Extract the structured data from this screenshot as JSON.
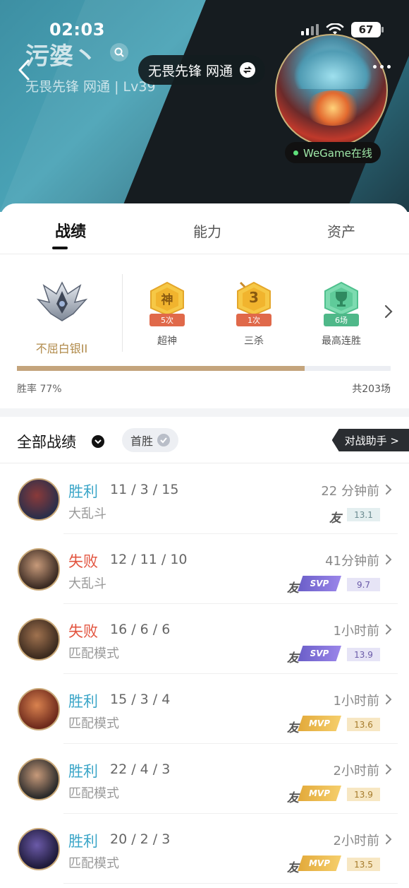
{
  "status_bar": {
    "time": "02:03",
    "battery": "67"
  },
  "profile": {
    "name": "污婆丶",
    "subtitle": "无畏先锋 网通 | Lv39",
    "server": "无畏先锋 网通",
    "online_status": "WeGame在线"
  },
  "tabs": [
    {
      "label": "战绩",
      "active": true
    },
    {
      "label": "能力",
      "active": false
    },
    {
      "label": "资产",
      "active": false
    }
  ],
  "rank": {
    "name": "不屈白银II"
  },
  "badges": [
    {
      "glyph": "神",
      "count": "5次",
      "label": "超神",
      "color": "#f2b63a"
    },
    {
      "glyph": "3",
      "count": "1次",
      "label": "三杀",
      "color": "#f2b63a"
    },
    {
      "glyph": "trophy-icon",
      "count": "6场",
      "label": "最高连胜",
      "color": "#5cc99a"
    }
  ],
  "stats": {
    "win_rate_label": "胜率 77%",
    "win_rate": 0.77,
    "total_label": "共203场"
  },
  "filter": {
    "title": "全部战绩",
    "chip": "首胜",
    "assistant": "对战助手 >"
  },
  "matches": [
    {
      "result": "胜利",
      "outcome": "win",
      "kda": "11 / 3 / 15",
      "mode": "大乱斗",
      "time": "22 分钟前",
      "friend": "友",
      "honor": "",
      "score": "13.1",
      "avatar_colors": [
        "#2b2f4a",
        "#8a3a3a"
      ]
    },
    {
      "result": "失败",
      "outcome": "lose",
      "kda": "12 / 11 / 10",
      "mode": "大乱斗",
      "time": "41分钟前",
      "friend": "友",
      "honor": "SVP",
      "score": "9.7",
      "avatar_colors": [
        "#3a2a22",
        "#c79a7a"
      ]
    },
    {
      "result": "失败",
      "outcome": "lose",
      "kda": "16 / 6 / 6",
      "mode": "匹配模式",
      "time": "1小时前",
      "friend": "友",
      "honor": "SVP",
      "score": "13.9",
      "avatar_colors": [
        "#3b2a1e",
        "#a0724f"
      ]
    },
    {
      "result": "胜利",
      "outcome": "win",
      "kda": "15 / 3 / 4",
      "mode": "匹配模式",
      "time": "1小时前",
      "friend": "友",
      "honor": "MVP",
      "score": "13.6",
      "avatar_colors": [
        "#6e2a1c",
        "#d9824f"
      ]
    },
    {
      "result": "胜利",
      "outcome": "win",
      "kda": "22 / 4 / 3",
      "mode": "匹配模式",
      "time": "2小时前",
      "friend": "友",
      "honor": "MVP",
      "score": "13.9",
      "avatar_colors": [
        "#2a2a2a",
        "#c79a7a"
      ]
    },
    {
      "result": "胜利",
      "outcome": "win",
      "kda": "20 / 2 / 3",
      "mode": "匹配模式",
      "time": "2小时前",
      "friend": "友",
      "honor": "MVP",
      "score": "13.5",
      "avatar_colors": [
        "#1e1a3a",
        "#6b5aa8"
      ]
    }
  ],
  "colors": {
    "win": "#3ba6c8",
    "lose": "#e2543f",
    "rank_gold": "#b08a4a",
    "winbar": "#c4a47c"
  }
}
